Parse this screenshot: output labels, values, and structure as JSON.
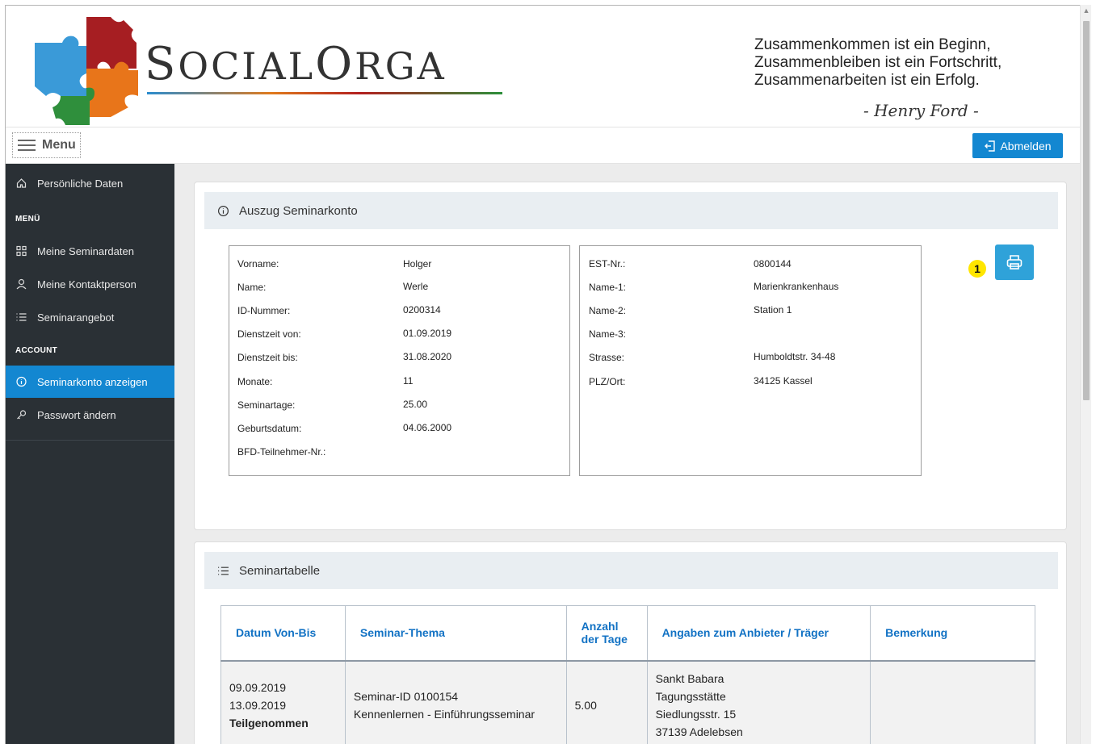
{
  "header": {
    "brand_initial_1": "S",
    "brand_rest_1": "OCIAL",
    "brand_initial_2": "O",
    "brand_rest_2": "RGA",
    "quote_line_1": "Zusammenkommen ist ein Beginn,",
    "quote_line_2": "Zusammenbleiben ist ein Fortschritt,",
    "quote_line_3": "Zusammenarbeiten ist ein Erfolg.",
    "quote_author": "- Henry Ford -"
  },
  "topbar": {
    "menu_label": "Menu",
    "logout_label": "Abmelden"
  },
  "sidebar": {
    "items": [
      {
        "label": "Persönliche Daten",
        "icon": "home-icon"
      },
      {
        "label": "Meine Seminardaten",
        "icon": "grid-icon"
      },
      {
        "label": "Meine Kontaktperson",
        "icon": "user-icon"
      },
      {
        "label": "Seminarangebot",
        "icon": "list-icon"
      },
      {
        "label": "Seminarkonto anzeigen",
        "icon": "info-icon",
        "active": true
      },
      {
        "label": "Passwort ändern",
        "icon": "key-icon"
      }
    ],
    "section_menu": "MENÜ",
    "section_account": "ACCOUNT"
  },
  "account_card": {
    "title": "Auszug Seminarkonto",
    "personal": [
      {
        "label": "Vorname:",
        "value": "Holger"
      },
      {
        "label": "Name:",
        "value": "Werle"
      },
      {
        "label": "ID-Nummer:",
        "value": "0200314"
      },
      {
        "label": "Dienstzeit von:",
        "value": "01.09.2019"
      },
      {
        "label": "Dienstzeit bis:",
        "value": "31.08.2020"
      },
      {
        "label": "Monate:",
        "value": "11"
      },
      {
        "label": "Seminartage:",
        "value": "25.00"
      },
      {
        "label": "Geburtsdatum:",
        "value": "04.06.2000"
      },
      {
        "label": "BFD-Teilnehmer-Nr.:",
        "value": ""
      }
    ],
    "institution": [
      {
        "label": "EST-Nr.:",
        "value": "0800144"
      },
      {
        "label": "Name-1:",
        "value": "Marienkrankenhaus"
      },
      {
        "label": "Name-2:",
        "value": "Station 1"
      },
      {
        "label": "Name-3:",
        "value": ""
      },
      {
        "label": "Strasse:",
        "value": "Humboldtstr. 34-48"
      },
      {
        "label": "PLZ/Ort:",
        "value": "34125 Kassel"
      }
    ],
    "badge_number": "1"
  },
  "seminar_card": {
    "title": "Seminartabelle",
    "columns": [
      "Datum Von-Bis",
      "Seminar-Thema",
      "Anzahl der Tage",
      "Angaben zum Anbieter / Träger",
      "Bemerkung"
    ],
    "rows": [
      {
        "date_from": "09.09.2019",
        "date_to": "13.09.2019",
        "status": "Teilgenommen",
        "seminar_id": "Seminar-ID 0100154",
        "seminar_topic": "Kennenlernen - Einführungsseminar",
        "days": "5.00",
        "provider_1": "Sankt Babara",
        "provider_2": "Tagungsstätte",
        "provider_3": "Siedlungsstr. 15",
        "provider_4": "37139 Adelebsen",
        "remark": ""
      }
    ]
  },
  "colors": {
    "primary": "#1387d1",
    "sidebar_bg": "#2a3035",
    "table_header_text": "#1272c4",
    "badge": "#ffe600"
  }
}
